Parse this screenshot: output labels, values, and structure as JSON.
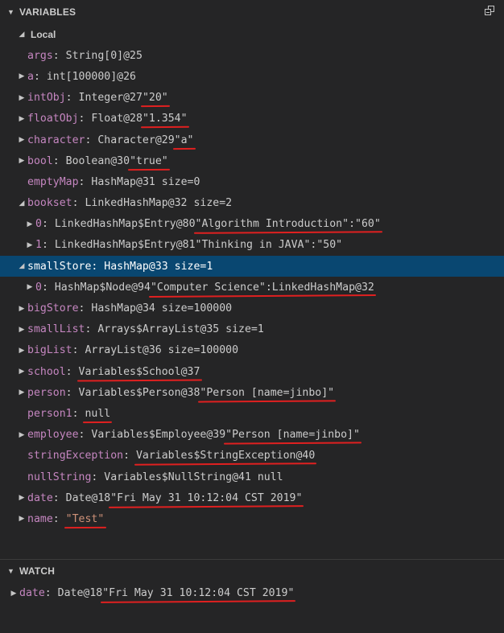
{
  "variables": {
    "title": "VARIABLES",
    "collapse_icon": "collapse-all-icon",
    "scope": "Local",
    "rows": [
      {
        "indent": 34,
        "twisty": "",
        "name": "args",
        "value": "String[0]@25",
        "str": ""
      },
      {
        "indent": 34,
        "twisty": "▶",
        "name": "a",
        "value": "int[100000]@26",
        "str": ""
      },
      {
        "indent": 34,
        "twisty": "▶",
        "name": "intObj",
        "value": "Integer@27 ",
        "str": "\"20\""
      },
      {
        "indent": 34,
        "twisty": "▶",
        "name": "floatObj",
        "value": "Float@28 ",
        "str": "\"1.354\""
      },
      {
        "indent": 34,
        "twisty": "▶",
        "name": "character",
        "value": "Character@29 ",
        "str": "\"a\""
      },
      {
        "indent": 34,
        "twisty": "▶",
        "name": "bool",
        "value": "Boolean@30 ",
        "str": "\"true\""
      },
      {
        "indent": 34,
        "twisty": "",
        "name": "emptyMap",
        "value": "HashMap@31 size=0",
        "str": ""
      },
      {
        "indent": 34,
        "twisty": "◢",
        "name": "bookset",
        "value": "LinkedHashMap@32 size=2",
        "str": ""
      },
      {
        "indent": 44,
        "twisty": "▶",
        "name": "0",
        "value": "LinkedHashMap$Entry@80 ",
        "str": "\"Algorithm Introduction\":\"60\""
      },
      {
        "indent": 44,
        "twisty": "▶",
        "name": "1",
        "value": "LinkedHashMap$Entry@81 ",
        "str": "\"Thinking in JAVA\":\"50\""
      },
      {
        "indent": 34,
        "twisty": "◢",
        "name": "smallStore",
        "value": "HashMap@33 size=1",
        "str": "",
        "selected": true
      },
      {
        "indent": 44,
        "twisty": "▶",
        "name": "0",
        "value": "HashMap$Node@94 ",
        "str": "\"Computer Science\":LinkedHashMap@32"
      },
      {
        "indent": 34,
        "twisty": "▶",
        "name": "bigStore",
        "value": "HashMap@34 size=100000",
        "str": ""
      },
      {
        "indent": 34,
        "twisty": "▶",
        "name": "smallList",
        "value": "Arrays$ArrayList@35 size=1",
        "str": ""
      },
      {
        "indent": 34,
        "twisty": "▶",
        "name": "bigList",
        "value": "ArrayList@36 size=100000",
        "str": ""
      },
      {
        "indent": 34,
        "twisty": "▶",
        "name": "school",
        "value": "Variables$School@37",
        "str": ""
      },
      {
        "indent": 34,
        "twisty": "▶",
        "name": "person",
        "value": "Variables$Person@38 ",
        "str": "\"Person [name=jinbo]\""
      },
      {
        "indent": 34,
        "twisty": "",
        "name": "person1",
        "value": "null",
        "str": ""
      },
      {
        "indent": 34,
        "twisty": "▶",
        "name": "employee",
        "value": "Variables$Employee@39 ",
        "str": "\"Person [name=jinbo]\""
      },
      {
        "indent": 34,
        "twisty": "",
        "name": "stringException",
        "value": "Variables$StringException@40",
        "str": ""
      },
      {
        "indent": 34,
        "twisty": "",
        "name": "nullString",
        "value": "Variables$NullString@41 null",
        "str": ""
      },
      {
        "indent": 34,
        "twisty": "▶",
        "name": "date",
        "value": "Date@18 ",
        "str": "\"Fri May 31 10:12:04 CST 2019\""
      },
      {
        "indent": 34,
        "twisty": "▶",
        "name": "name",
        "value": "",
        "str": "\"Test\"",
        "strcolor": "#ce9178"
      }
    ]
  },
  "watch": {
    "title": "WATCH",
    "rows": [
      {
        "indent": 24,
        "twisty": "▶",
        "name": "date",
        "value": "Date@18 ",
        "str": "\"Fri May 31 10:12:04 CST 2019\""
      }
    ]
  },
  "colors": {
    "background": "#252526",
    "name": "#c586c0",
    "value": "#cccccc",
    "string": "#ce9178",
    "selection": "#094771",
    "annotation": "#e02020"
  }
}
